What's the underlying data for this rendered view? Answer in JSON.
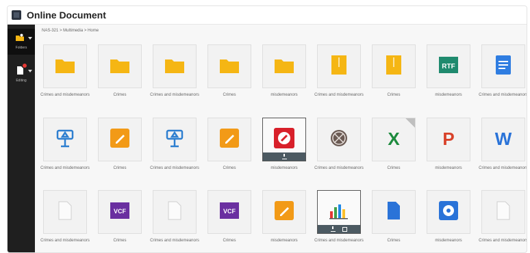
{
  "app": {
    "title": "Online Document"
  },
  "sidebar": {
    "items": [
      {
        "label": "Folders",
        "icon": "folder-icon",
        "active": true
      },
      {
        "label": "Editing",
        "icon": "document-icon",
        "active": false,
        "badge": true
      }
    ]
  },
  "breadcrumb": "NAS-321 > Multimedia > Home",
  "tiles": [
    {
      "type": "folder",
      "caption": "Crimes and misdemeanors"
    },
    {
      "type": "folder",
      "caption": "Crimes"
    },
    {
      "type": "folder",
      "caption": "Crimes and misdemeanors"
    },
    {
      "type": "folder",
      "caption": "Crimes"
    },
    {
      "type": "folder",
      "caption": "misdemeanors"
    },
    {
      "type": "archive",
      "caption": "Crimes and misdemeanors"
    },
    {
      "type": "archive",
      "caption": "Crimes"
    },
    {
      "type": "rtf",
      "caption": "misdemeanors",
      "label": "RTF"
    },
    {
      "type": "gdoc",
      "caption": "Crimes and misdemeanors"
    },
    {
      "type": "keynote",
      "caption": "Crimes and misdemeanors"
    },
    {
      "type": "pages",
      "caption": "Crimes"
    },
    {
      "type": "keynote",
      "caption": "Crimes and misdemeanors"
    },
    {
      "type": "pages",
      "caption": "Crimes"
    },
    {
      "type": "pdfred",
      "caption": "misdemeanors",
      "hover": true
    },
    {
      "type": "dvd",
      "caption": "Crimes and misdemeanors"
    },
    {
      "type": "excel",
      "caption": "Crimes",
      "label": "X",
      "fold": true
    },
    {
      "type": "ppt",
      "caption": "misdemeanors",
      "label": "P"
    },
    {
      "type": "word",
      "caption": "Crimes and misdemeanors",
      "label": "W"
    },
    {
      "type": "blank",
      "caption": "Crimes and misdemeanors"
    },
    {
      "type": "vcf",
      "caption": "Crimes",
      "label": "VCF"
    },
    {
      "type": "blank",
      "caption": "Crimes and misdemeanors"
    },
    {
      "type": "vcf",
      "caption": "Crimes",
      "label": "VCF"
    },
    {
      "type": "pages",
      "caption": "misdemeanors"
    },
    {
      "type": "chart",
      "caption": "Crimes and misdemeanors",
      "hover": true
    },
    {
      "type": "bluedoc",
      "caption": "Crimes"
    },
    {
      "type": "disc",
      "caption": "misdemeanors"
    },
    {
      "type": "blank",
      "caption": "Crimes and misdemeanors"
    }
  ],
  "colors": {
    "folder": "#f5b614",
    "rtf": "#1f8a6e",
    "gdoc": "#2f7de1",
    "excel": "#1e8b3e",
    "ppt": "#d8422a",
    "word": "#2a73d8",
    "vcf": "#6a2fa0",
    "pages": "#f29a17",
    "keynote": "#2e7fd0",
    "pdfred": "#d8202a"
  }
}
